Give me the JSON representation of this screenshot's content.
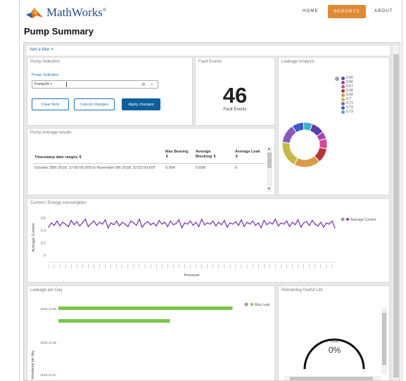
{
  "header": {
    "brand": "MathWorks",
    "brand_mark": "®",
    "nav": [
      {
        "label": "HOME",
        "active": false
      },
      {
        "label": "REPORTS",
        "active": true
      },
      {
        "label": "ABOUT",
        "active": false
      }
    ],
    "accent_color": "#e08a36"
  },
  "page_title": "Pump Summary",
  "filter_bar": {
    "add_filter_label": "Add a filter",
    "plus": "+"
  },
  "pump_selection": {
    "title": "Pump Selection",
    "field_label": "Pump Selection",
    "selected_tag": "Pump24",
    "tag_remove": "×",
    "clear_icon": "⊗",
    "dropdown_icon": "⌄",
    "buttons": {
      "clear": "Clear form",
      "cancel": "Cancel changes",
      "apply": "Apply changes"
    }
  },
  "fault_events": {
    "title": "Fault Events",
    "value": "46",
    "caption": "Fault Events"
  },
  "leakage_analysis": {
    "title": "Leakage Analysis",
    "info": "i",
    "chart_data": {
      "type": "pie",
      "variant": "donut",
      "legend_placement": "top-right",
      "categories": [
        "0.65",
        "0.66",
        "0.67",
        "0.68",
        "0.69",
        "0.7",
        "0.71",
        "0.72",
        "0.73"
      ],
      "values": [
        9,
        5,
        7,
        10,
        18,
        18,
        13,
        8,
        6
      ],
      "colors": [
        "#5b3fa8",
        "#a83fb0",
        "#d24a9a",
        "#b8363a",
        "#d99a4a",
        "#c7b84a",
        "#8a5ab8",
        "#3a5ad0",
        "#3ab0c8"
      ]
    }
  },
  "pump_avg": {
    "title": "Pump Average results",
    "columns": [
      "Timestamp date ranges",
      "Max Bearing",
      "Average Blocking",
      "Average Leak"
    ],
    "sort_icon": "⇕",
    "rows": [
      {
        "range": "October 28th 2018, 17:00:00.000 to November 8th 2018, 22:52:59.697",
        "max_bearing": "0.004",
        "avg_blocking": "0.698",
        "avg_leak": "0"
      }
    ],
    "scroll_up": "▲",
    "scroll_down": "▼"
  },
  "current_energy": {
    "title": "Current / Energy consumption",
    "chart_data": {
      "type": "line",
      "xlabel": "Pressure",
      "ylabel": "Average Current",
      "ylim": [
        0,
        0.6
      ],
      "yticks": [
        "0.6",
        "0.4",
        "0.2",
        "0"
      ],
      "legend_placement": "top-right",
      "grid": false,
      "series": [
        {
          "name": "Average Current",
          "color": "#7b3fa8",
          "values": [
            0.45,
            0.52,
            0.48,
            0.55,
            0.47,
            0.53,
            0.5,
            0.46,
            0.56,
            0.49,
            0.54,
            0.47,
            0.52,
            0.58,
            0.46,
            0.51,
            0.55,
            0.48,
            0.53,
            0.5,
            0.57,
            0.44,
            0.52,
            0.49,
            0.55,
            0.47,
            0.53,
            0.5,
            0.46,
            0.55,
            0.52,
            0.48,
            0.58,
            0.45,
            0.51,
            0.54,
            0.49,
            0.52,
            0.47,
            0.56,
            0.5,
            0.53,
            0.46,
            0.55,
            0.49,
            0.51,
            0.57,
            0.44,
            0.52,
            0.5,
            0.55,
            0.48,
            0.53,
            0.46,
            0.58,
            0.49,
            0.52,
            0.5,
            0.55,
            0.47,
            0.53,
            0.49,
            0.56,
            0.45,
            0.52,
            0.5,
            0.54,
            0.48,
            0.57,
            0.46,
            0.53,
            0.5,
            0.55,
            0.48,
            0.52,
            0.44,
            0.56,
            0.49,
            0.53,
            0.5,
            0.58,
            0.47,
            0.52,
            0.5,
            0.55,
            0.46,
            0.53,
            0.49,
            0.57,
            0.45,
            0.52,
            0.54,
            0.48,
            0.56,
            0.5,
            0.47,
            0.53,
            0.45,
            0.52,
            0.5,
            0.55,
            0.44
          ]
        }
      ]
    }
  },
  "leakage_per_day": {
    "title": "Leakage per Day",
    "info": "i",
    "chart_data": {
      "type": "bar",
      "orientation": "horizontal",
      "ylabel": "timestamp per day",
      "xlim": [
        0,
        1
      ],
      "legend_placement": "top-right",
      "categories": [
        "2018-11-05",
        "2018-11-06",
        "2018-11-07"
      ],
      "tick_labels": [
        "2018-11-05",
        "2018-11-06",
        "2018-11-07"
      ],
      "series": [
        {
          "name": "Max Leak",
          "color": "#7dc54b",
          "values": [
            0.89,
            0.57
          ]
        }
      ]
    }
  },
  "rul": {
    "title": "Remaining Useful Life",
    "label": "RUL",
    "value_text": "0%",
    "level": 0
  }
}
